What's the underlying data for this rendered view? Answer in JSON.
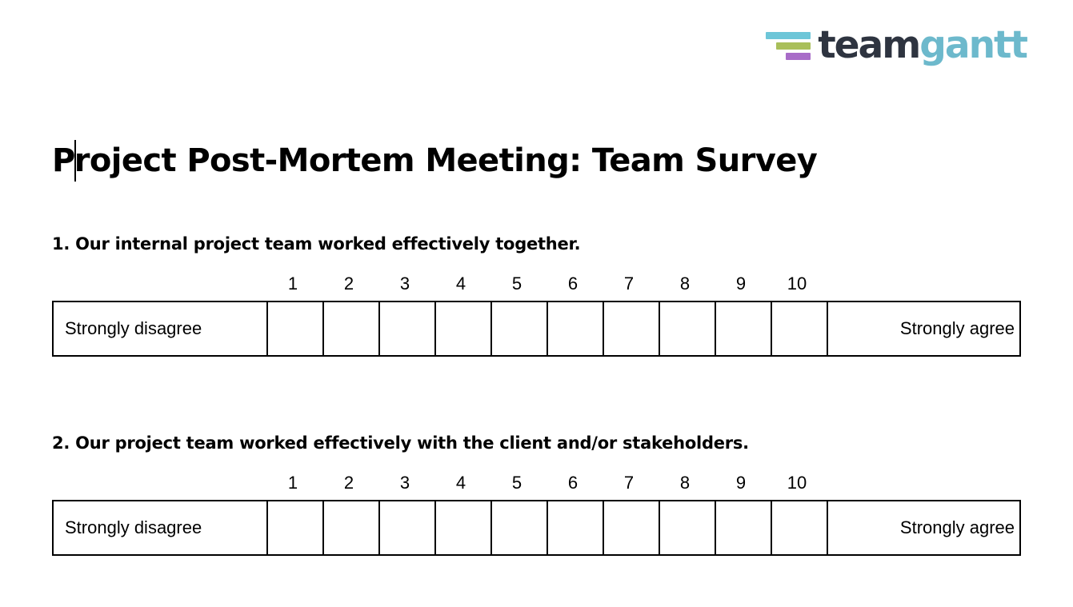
{
  "brand": {
    "name": "teamgantt",
    "word_part_dark": "team",
    "word_part_accent": "gantt",
    "color_dark": "#2E3440",
    "color_accent": "#6DB9CC",
    "mark_bar_colors": [
      "#6DC6D8",
      "#A9BF5A",
      "#A86CC8"
    ],
    "icon_name": "teamgantt-logo"
  },
  "document": {
    "title": "Project Post-Mortem Meeting: Team Survey",
    "title_before_caret": "P",
    "title_after_caret": "roject Post-Mortem Meeting: Team Survey",
    "caret_visible": true
  },
  "scale": {
    "numbers": [
      "1",
      "2",
      "3",
      "4",
      "5",
      "6",
      "7",
      "8",
      "9",
      "10"
    ],
    "low_label": "Strongly disagree",
    "high_label": "Strongly agree",
    "min": 1,
    "max": 10
  },
  "questions": [
    {
      "number": "1.",
      "text": "1. Our internal project team worked effectively together."
    },
    {
      "number": "2.",
      "text": "2. Our project team worked effectively with the client and/or stakeholders."
    }
  ]
}
